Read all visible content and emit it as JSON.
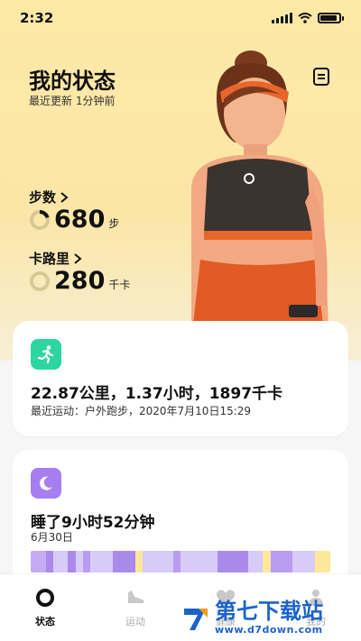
{
  "status_bar": {
    "time": "2:32"
  },
  "header": {
    "title": "我的状态",
    "subtitle": "最近更新 1分钟前"
  },
  "metrics": {
    "steps": {
      "label": "步数",
      "value": "680",
      "unit": "步",
      "progress": 0.2
    },
    "calories": {
      "label": "卡路里",
      "value": "280",
      "unit": "千卡",
      "progress": 0.0
    }
  },
  "workout_card": {
    "headline": "22.87公里，1.37小时，1897千卡",
    "detail": "最近运动：户外跑步，2020年7月10日15:29",
    "icon_color": "#2dd6a1"
  },
  "sleep_card": {
    "headline": "睡了9小时52分钟",
    "date": "6月30日",
    "icon_color": "#a77df2",
    "segments": [
      {
        "color": "#c3acf4",
        "weight": 2
      },
      {
        "color": "#a98aea",
        "weight": 1
      },
      {
        "color": "#d7cbf8",
        "weight": 2
      },
      {
        "color": "#a98aea",
        "weight": 1
      },
      {
        "color": "#d7cbf8",
        "weight": 1
      },
      {
        "color": "#b79cf0",
        "weight": 1
      },
      {
        "color": "#d7cbf8",
        "weight": 3
      },
      {
        "color": "#a98aea",
        "weight": 3
      },
      {
        "color": "#fde79a",
        "weight": 1
      },
      {
        "color": "#d7cbf8",
        "weight": 4
      },
      {
        "color": "#b79cf0",
        "weight": 1
      },
      {
        "color": "#d7cbf8",
        "weight": 5
      },
      {
        "color": "#a98aea",
        "weight": 4
      },
      {
        "color": "#d7cbf8",
        "weight": 2
      },
      {
        "color": "#fde79a",
        "weight": 1
      },
      {
        "color": "#b79cf0",
        "weight": 3
      },
      {
        "color": "#d7cbf8",
        "weight": 3
      },
      {
        "color": "#fde79a",
        "weight": 2
      }
    ]
  },
  "tabs": [
    {
      "label": "状态",
      "icon": "status-ring-icon",
      "active": true
    },
    {
      "label": "运动",
      "icon": "shoe-icon",
      "active": false
    },
    {
      "label": "健康",
      "icon": "heart-icon",
      "active": false
    },
    {
      "label": "我的",
      "icon": "person-icon",
      "active": false
    }
  ],
  "watermark": {
    "text": "第七下载站",
    "url": "www.d7down.com"
  },
  "colors": {
    "hero_bg": "#fde9a6",
    "ring_track": "#d8c893",
    "ring_progress": "#111111",
    "brand_blue": "#1a63c9"
  }
}
